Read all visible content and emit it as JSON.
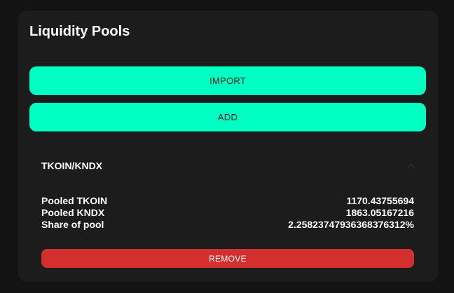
{
  "page": {
    "title": "Liquidity Pools"
  },
  "actions": {
    "import_label": "IMPORT",
    "add_label": "ADD"
  },
  "pool": {
    "name": "TKOIN/KNDX",
    "expanded": true,
    "rows": [
      {
        "label": "Pooled TKOIN",
        "value": "1170.43755694"
      },
      {
        "label": "Pooled KNDX",
        "value": "1863.05167216"
      },
      {
        "label": "Share of pool",
        "value": "2.2582374793636837631​2%"
      }
    ],
    "remove_label": "REMOVE"
  },
  "colors": {
    "background": "#131313",
    "card": "#1c1c1c",
    "accent": "#00ffc3",
    "danger": "#d32f2f"
  },
  "icons": {
    "expand_toggle": "chevron-up-icon"
  }
}
